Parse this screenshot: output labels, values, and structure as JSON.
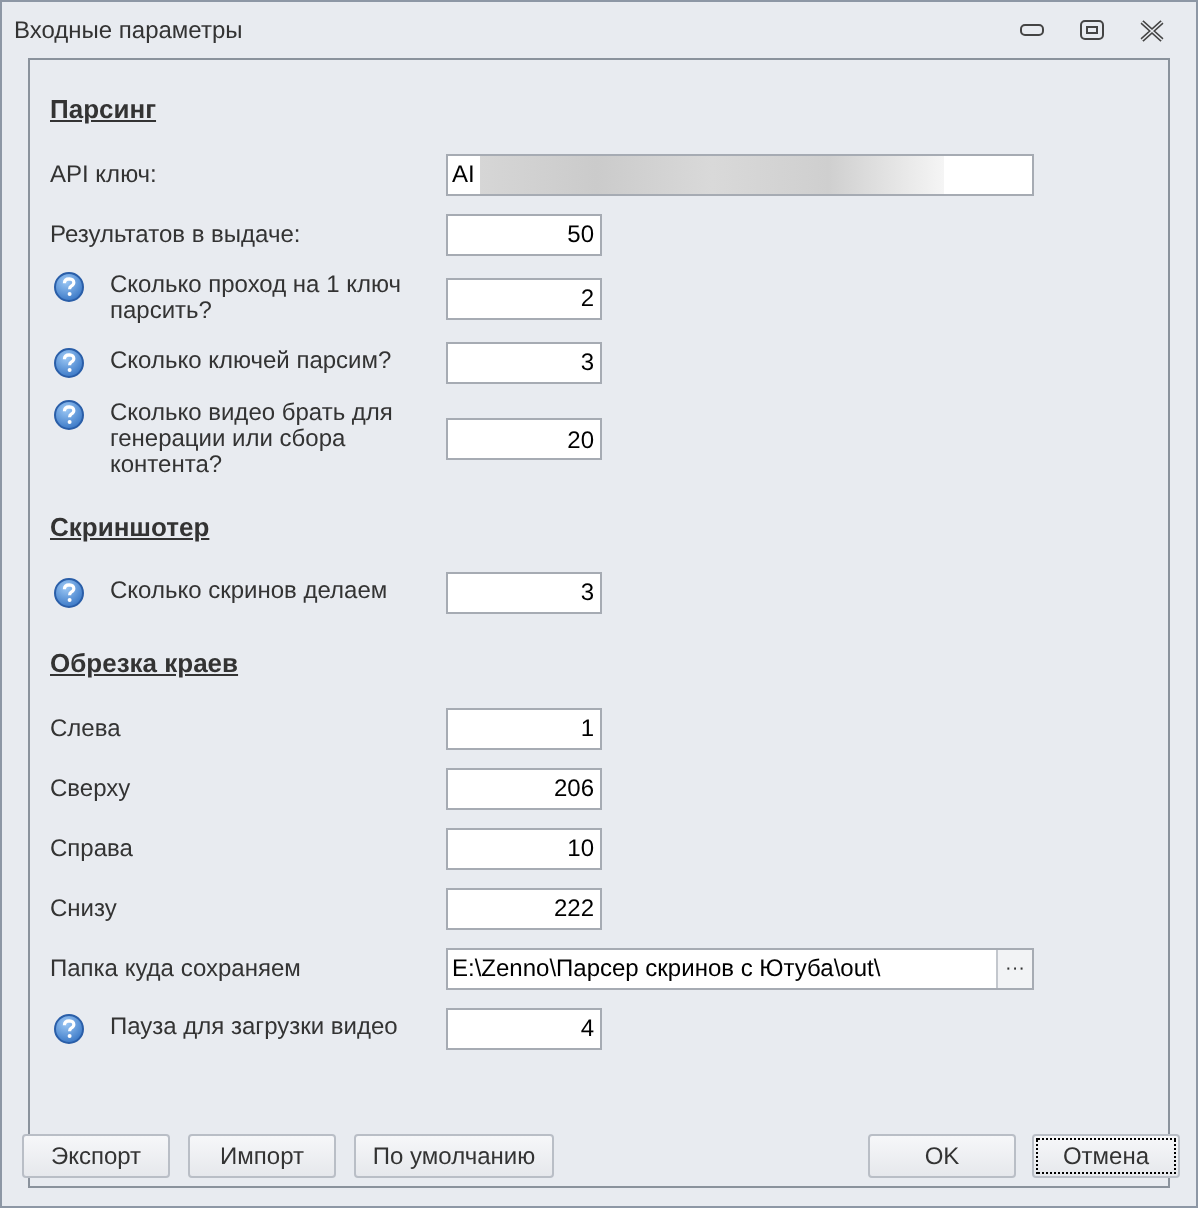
{
  "window": {
    "title": "Входные параметры"
  },
  "items": [
    {
      "kind": "section",
      "label": "Парсинг"
    },
    {
      "kind": "text",
      "label": "API ключ:",
      "help": false,
      "value": "AI",
      "wide": true
    },
    {
      "kind": "number",
      "label": "Результатов в выдаче:",
      "help": false,
      "value": "50"
    },
    {
      "kind": "number",
      "label": "Сколько проход на 1 ключ парсить?",
      "help": true,
      "value": "2"
    },
    {
      "kind": "number",
      "label": "Сколько ключей парсим?",
      "help": true,
      "value": "3"
    },
    {
      "kind": "number",
      "label": "Сколько видео брать для генерации или сбора контента?",
      "help": true,
      "value": "20"
    },
    {
      "kind": "section",
      "label": "Скриншотер"
    },
    {
      "kind": "number",
      "label": "Сколько скринов делаем",
      "help": true,
      "value": "3"
    },
    {
      "kind": "section",
      "label": "Обрезка краев"
    },
    {
      "kind": "number",
      "label": "Слева",
      "help": false,
      "value": "1"
    },
    {
      "kind": "number",
      "label": "Сверху",
      "help": false,
      "value": "206"
    },
    {
      "kind": "number",
      "label": "Справа",
      "help": false,
      "value": "10"
    },
    {
      "kind": "number",
      "label": "Снизу",
      "help": false,
      "value": "222"
    },
    {
      "kind": "path",
      "label": "Папка куда сохраняем",
      "help": false,
      "value": "E:\\Zenno\\Парсер скринов с Ютуба\\out\\",
      "browse": "···"
    },
    {
      "kind": "number",
      "label": "Пауза для загрузки видео",
      "help": true,
      "value": "4"
    }
  ],
  "buttons_left": [
    "Экспорт",
    "Импорт",
    "По умолчанию"
  ],
  "buttons_right": [
    {
      "label": "OK",
      "focused": false
    },
    {
      "label": "Отмена",
      "focused": true
    }
  ]
}
